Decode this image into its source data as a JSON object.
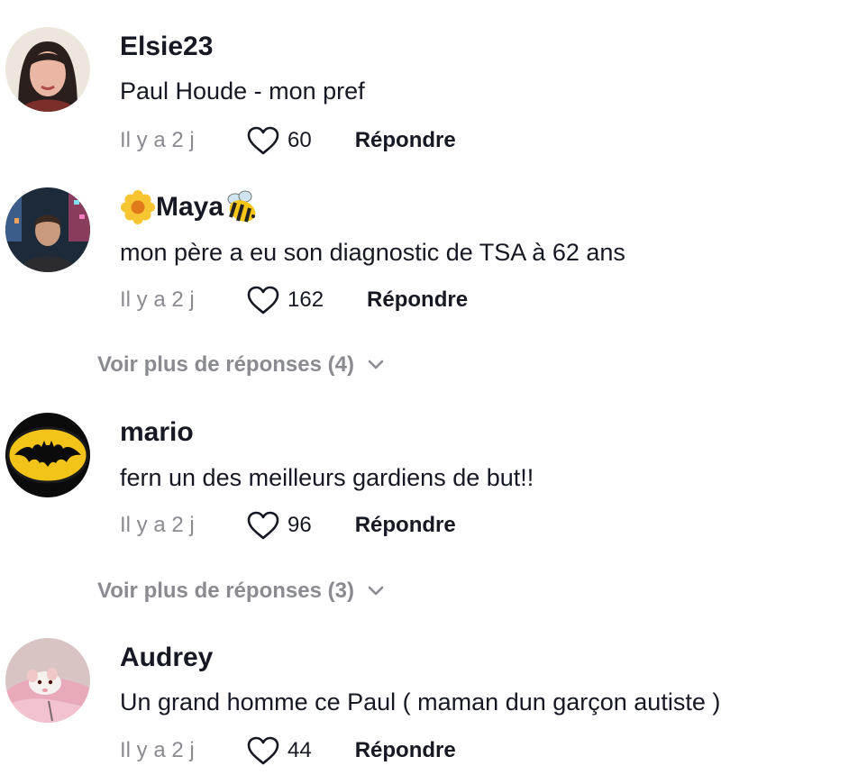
{
  "colors": {
    "primary_text": "#161823",
    "secondary_text": "#8a8b91",
    "background": "#ffffff"
  },
  "comments": [
    {
      "username": "Elsie23",
      "text": "Paul Houde - mon pref",
      "time": "Il y a 2 j",
      "likes": "60",
      "reply_label": "Répondre",
      "avatar_icon": "woman-portrait-avatar"
    },
    {
      "username": "Maya",
      "username_emoji_left": "flower-emoji",
      "username_emoji_right": "bee-emoji",
      "text": "mon père a eu son diagnostic de TSA à 62 ans",
      "time": "Il y a 2 j",
      "likes": "162",
      "reply_label": "Répondre",
      "avatar_icon": "city-night-portrait-avatar",
      "more_replies": "Voir plus de réponses (4)"
    },
    {
      "username": "mario",
      "text": "fern un des meilleurs gardiens de but!!",
      "time": "Il y a 2 j",
      "likes": "96",
      "reply_label": "Répondre",
      "avatar_icon": "batman-logo-avatar",
      "more_replies": "Voir plus de réponses (3)"
    },
    {
      "username": "Audrey",
      "text": "Un grand homme ce Paul ( maman dun garçon autiste )",
      "time": "Il y a 2 j",
      "likes": "44",
      "reply_label": "Répondre",
      "avatar_icon": "pet-rat-avatar"
    }
  ]
}
